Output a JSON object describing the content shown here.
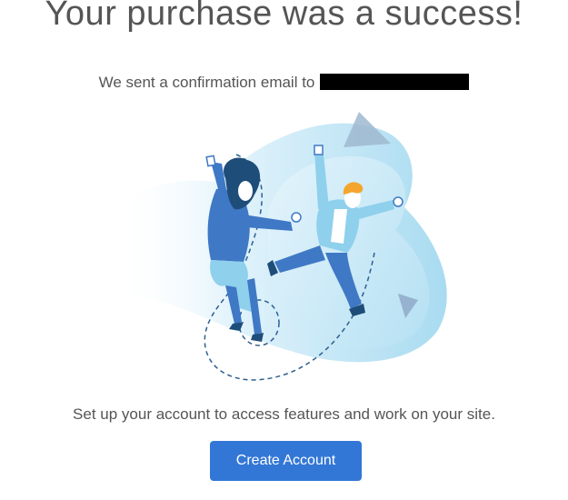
{
  "heading": "Your purchase was a success!",
  "confirmation": {
    "text": "We sent a confirmation email to",
    "email_redacted": true
  },
  "illustration": {
    "icon": "celebrating-people-illustration"
  },
  "subtitle": "Set up your account to access features and work on your site.",
  "actions": {
    "create_account_label": "Create Account"
  },
  "colors": {
    "primary": "#3377d6",
    "text": "#555555",
    "illustration_light": "#cfeaf7",
    "illustration_mid": "#8fd0ec",
    "illustration_dark": "#3a6fb8"
  }
}
